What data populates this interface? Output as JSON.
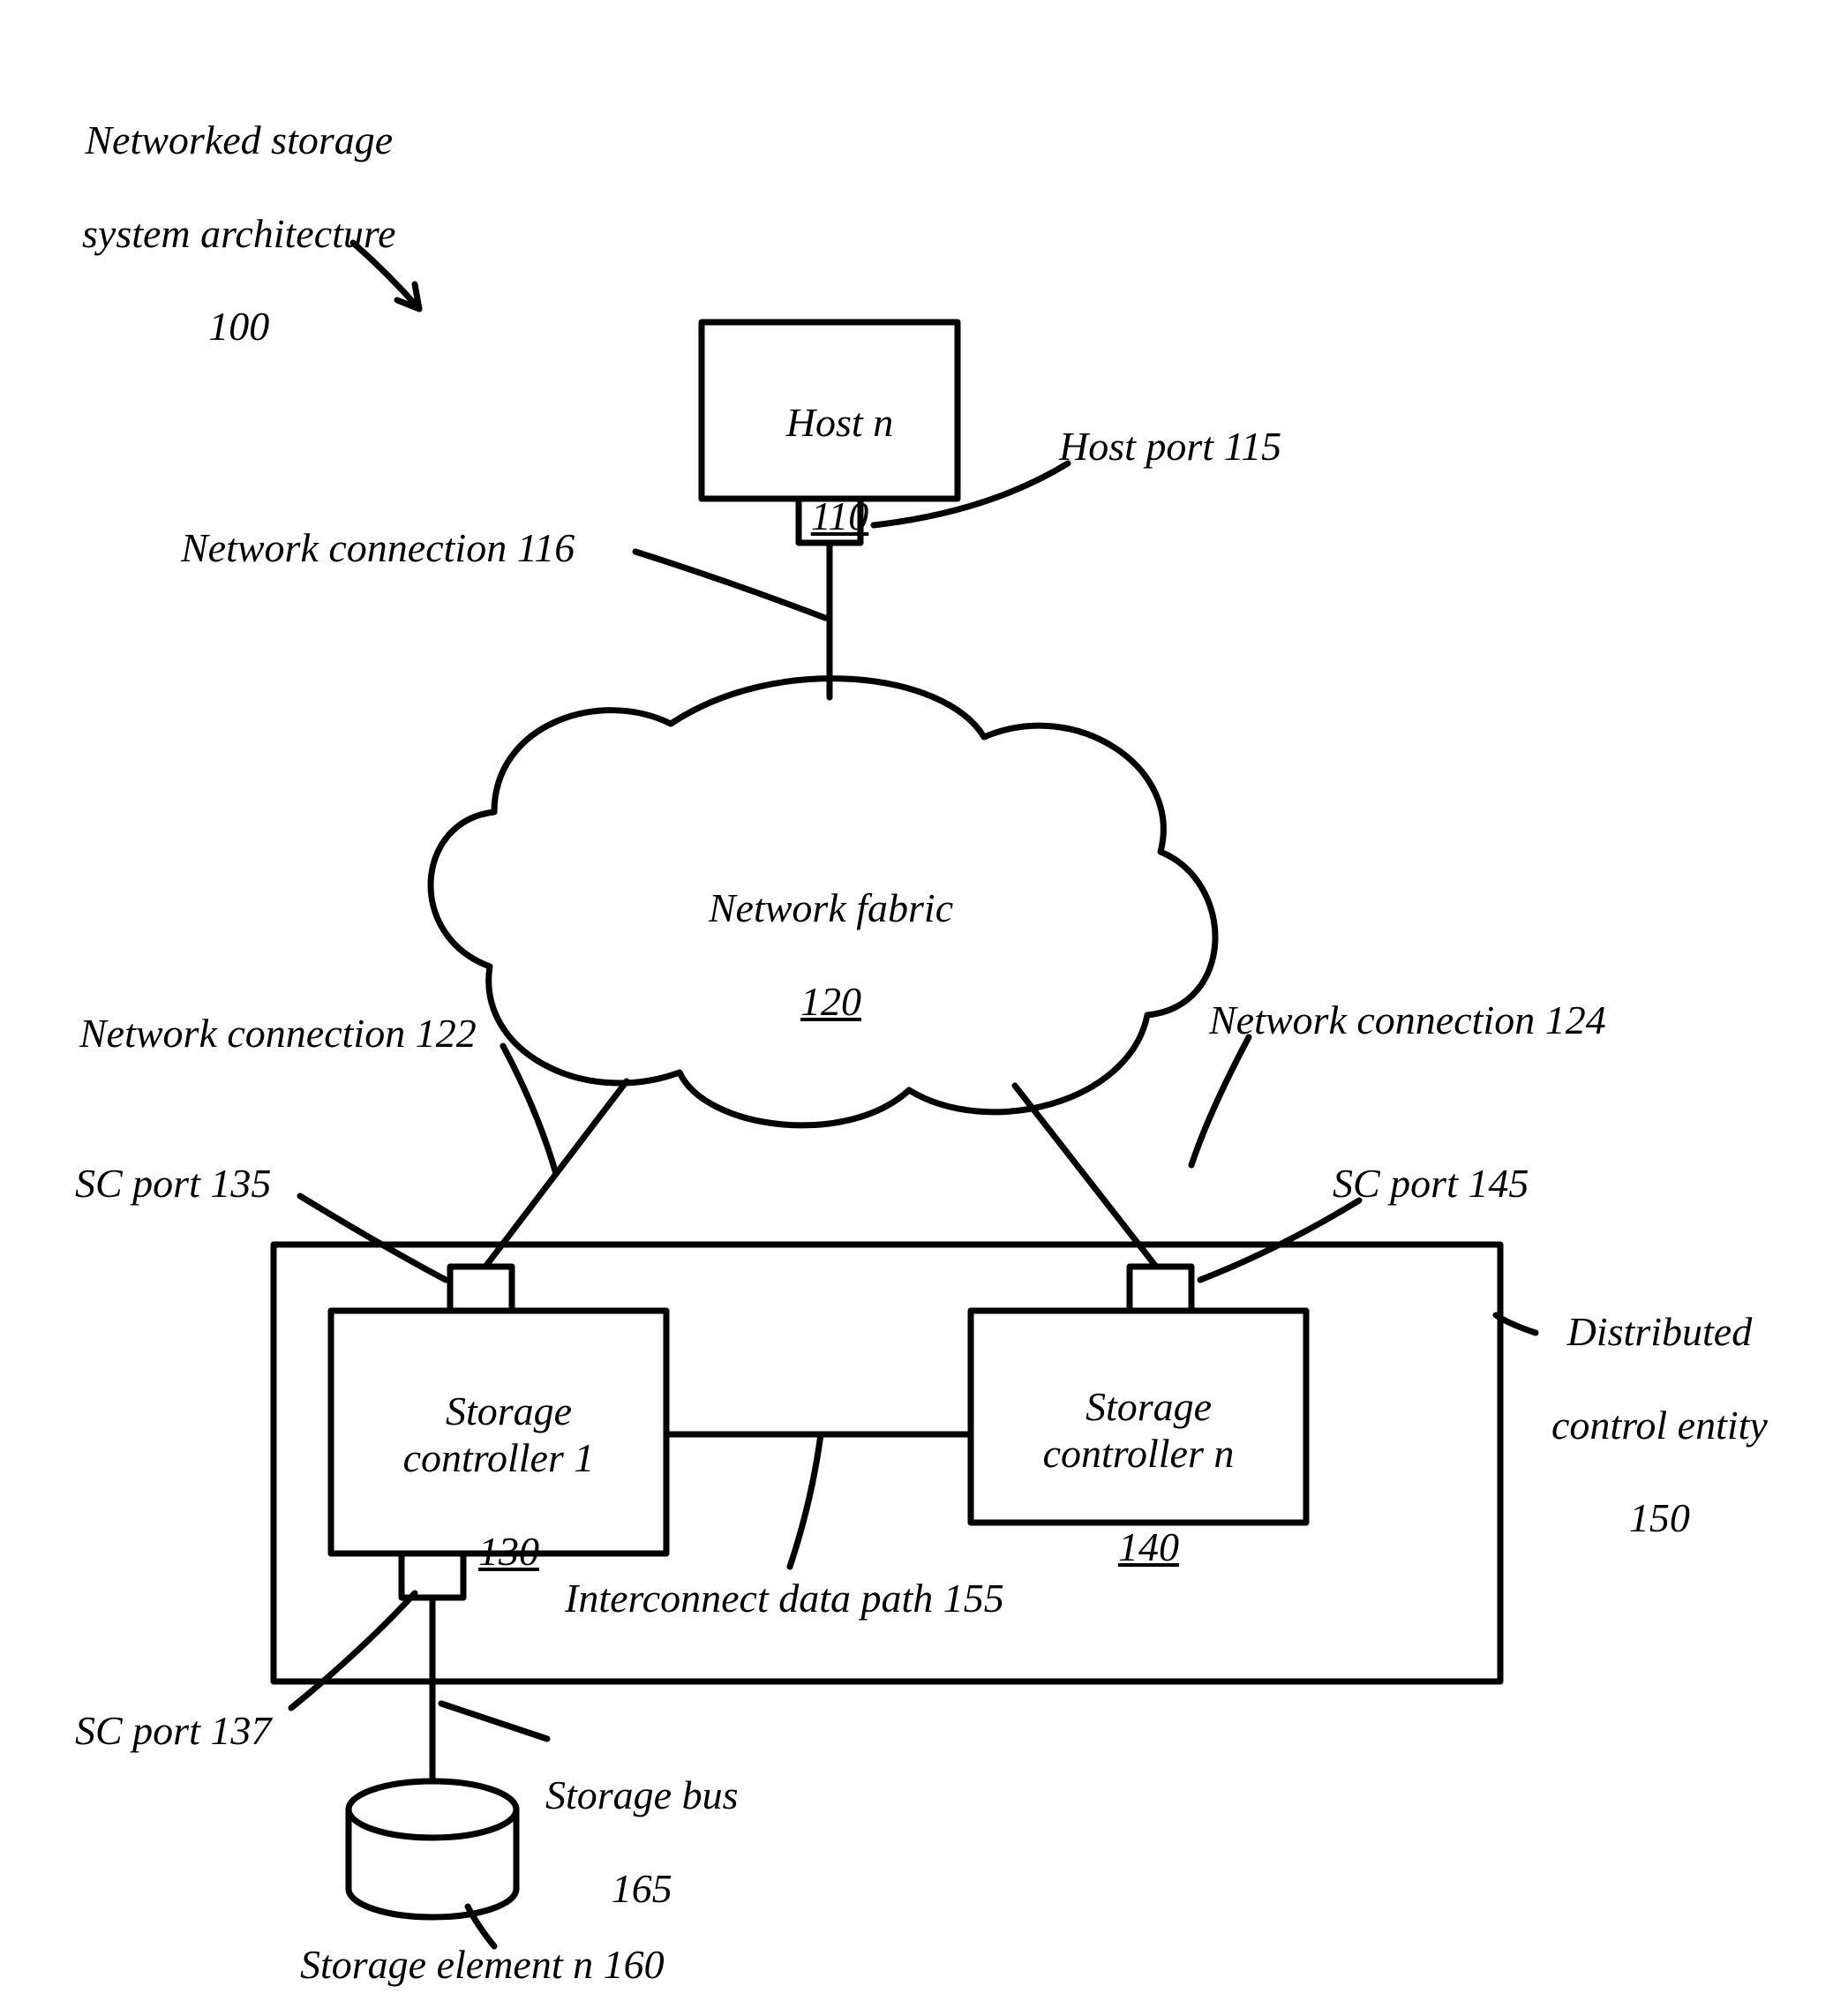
{
  "title": {
    "line1": "Networked storage",
    "line2": "system architecture",
    "num": "100"
  },
  "host": {
    "name": "Host n",
    "num": "110"
  },
  "host_port": {
    "text": "Host port 115"
  },
  "netconn116": {
    "text": "Network connection 116"
  },
  "fabric": {
    "name": "Network fabric",
    "num": "120"
  },
  "netconn122": {
    "text": "Network connection 122"
  },
  "netconn124": {
    "text": "Network connection 124"
  },
  "scport135": {
    "text": "SC port 135"
  },
  "scport145": {
    "text": "SC port 145"
  },
  "sc1": {
    "name": "Storage\ncontroller 1",
    "num": "130"
  },
  "scn": {
    "name": "Storage\ncontroller n",
    "num": "140"
  },
  "interconnect": {
    "text": "Interconnect data path 155"
  },
  "dce": {
    "line1": "Distributed",
    "line2": "control entity",
    "num": "150"
  },
  "scport137": {
    "text": "SC port 137"
  },
  "storagebus": {
    "line1": "Storage bus",
    "num": "165"
  },
  "storage_el": {
    "text": "Storage element n 160"
  }
}
